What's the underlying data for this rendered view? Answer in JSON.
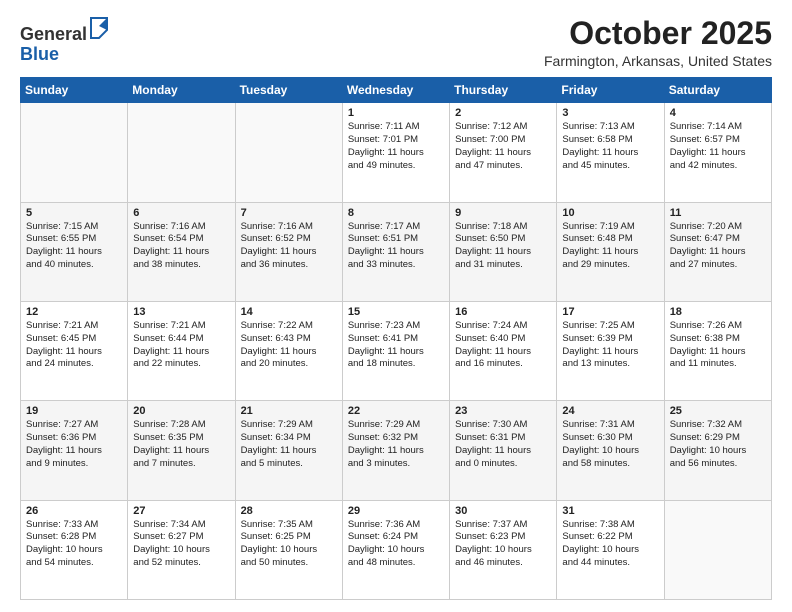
{
  "logo": {
    "line1": "General",
    "line2": "Blue"
  },
  "header": {
    "month": "October 2025",
    "location": "Farmington, Arkansas, United States"
  },
  "weekdays": [
    "Sunday",
    "Monday",
    "Tuesday",
    "Wednesday",
    "Thursday",
    "Friday",
    "Saturday"
  ],
  "weeks": [
    [
      {
        "day": "",
        "info": ""
      },
      {
        "day": "",
        "info": ""
      },
      {
        "day": "",
        "info": ""
      },
      {
        "day": "1",
        "info": "Sunrise: 7:11 AM\nSunset: 7:01 PM\nDaylight: 11 hours\nand 49 minutes."
      },
      {
        "day": "2",
        "info": "Sunrise: 7:12 AM\nSunset: 7:00 PM\nDaylight: 11 hours\nand 47 minutes."
      },
      {
        "day": "3",
        "info": "Sunrise: 7:13 AM\nSunset: 6:58 PM\nDaylight: 11 hours\nand 45 minutes."
      },
      {
        "day": "4",
        "info": "Sunrise: 7:14 AM\nSunset: 6:57 PM\nDaylight: 11 hours\nand 42 minutes."
      }
    ],
    [
      {
        "day": "5",
        "info": "Sunrise: 7:15 AM\nSunset: 6:55 PM\nDaylight: 11 hours\nand 40 minutes."
      },
      {
        "day": "6",
        "info": "Sunrise: 7:16 AM\nSunset: 6:54 PM\nDaylight: 11 hours\nand 38 minutes."
      },
      {
        "day": "7",
        "info": "Sunrise: 7:16 AM\nSunset: 6:52 PM\nDaylight: 11 hours\nand 36 minutes."
      },
      {
        "day": "8",
        "info": "Sunrise: 7:17 AM\nSunset: 6:51 PM\nDaylight: 11 hours\nand 33 minutes."
      },
      {
        "day": "9",
        "info": "Sunrise: 7:18 AM\nSunset: 6:50 PM\nDaylight: 11 hours\nand 31 minutes."
      },
      {
        "day": "10",
        "info": "Sunrise: 7:19 AM\nSunset: 6:48 PM\nDaylight: 11 hours\nand 29 minutes."
      },
      {
        "day": "11",
        "info": "Sunrise: 7:20 AM\nSunset: 6:47 PM\nDaylight: 11 hours\nand 27 minutes."
      }
    ],
    [
      {
        "day": "12",
        "info": "Sunrise: 7:21 AM\nSunset: 6:45 PM\nDaylight: 11 hours\nand 24 minutes."
      },
      {
        "day": "13",
        "info": "Sunrise: 7:21 AM\nSunset: 6:44 PM\nDaylight: 11 hours\nand 22 minutes."
      },
      {
        "day": "14",
        "info": "Sunrise: 7:22 AM\nSunset: 6:43 PM\nDaylight: 11 hours\nand 20 minutes."
      },
      {
        "day": "15",
        "info": "Sunrise: 7:23 AM\nSunset: 6:41 PM\nDaylight: 11 hours\nand 18 minutes."
      },
      {
        "day": "16",
        "info": "Sunrise: 7:24 AM\nSunset: 6:40 PM\nDaylight: 11 hours\nand 16 minutes."
      },
      {
        "day": "17",
        "info": "Sunrise: 7:25 AM\nSunset: 6:39 PM\nDaylight: 11 hours\nand 13 minutes."
      },
      {
        "day": "18",
        "info": "Sunrise: 7:26 AM\nSunset: 6:38 PM\nDaylight: 11 hours\nand 11 minutes."
      }
    ],
    [
      {
        "day": "19",
        "info": "Sunrise: 7:27 AM\nSunset: 6:36 PM\nDaylight: 11 hours\nand 9 minutes."
      },
      {
        "day": "20",
        "info": "Sunrise: 7:28 AM\nSunset: 6:35 PM\nDaylight: 11 hours\nand 7 minutes."
      },
      {
        "day": "21",
        "info": "Sunrise: 7:29 AM\nSunset: 6:34 PM\nDaylight: 11 hours\nand 5 minutes."
      },
      {
        "day": "22",
        "info": "Sunrise: 7:29 AM\nSunset: 6:32 PM\nDaylight: 11 hours\nand 3 minutes."
      },
      {
        "day": "23",
        "info": "Sunrise: 7:30 AM\nSunset: 6:31 PM\nDaylight: 11 hours\nand 0 minutes."
      },
      {
        "day": "24",
        "info": "Sunrise: 7:31 AM\nSunset: 6:30 PM\nDaylight: 10 hours\nand 58 minutes."
      },
      {
        "day": "25",
        "info": "Sunrise: 7:32 AM\nSunset: 6:29 PM\nDaylight: 10 hours\nand 56 minutes."
      }
    ],
    [
      {
        "day": "26",
        "info": "Sunrise: 7:33 AM\nSunset: 6:28 PM\nDaylight: 10 hours\nand 54 minutes."
      },
      {
        "day": "27",
        "info": "Sunrise: 7:34 AM\nSunset: 6:27 PM\nDaylight: 10 hours\nand 52 minutes."
      },
      {
        "day": "28",
        "info": "Sunrise: 7:35 AM\nSunset: 6:25 PM\nDaylight: 10 hours\nand 50 minutes."
      },
      {
        "day": "29",
        "info": "Sunrise: 7:36 AM\nSunset: 6:24 PM\nDaylight: 10 hours\nand 48 minutes."
      },
      {
        "day": "30",
        "info": "Sunrise: 7:37 AM\nSunset: 6:23 PM\nDaylight: 10 hours\nand 46 minutes."
      },
      {
        "day": "31",
        "info": "Sunrise: 7:38 AM\nSunset: 6:22 PM\nDaylight: 10 hours\nand 44 minutes."
      },
      {
        "day": "",
        "info": ""
      }
    ]
  ]
}
